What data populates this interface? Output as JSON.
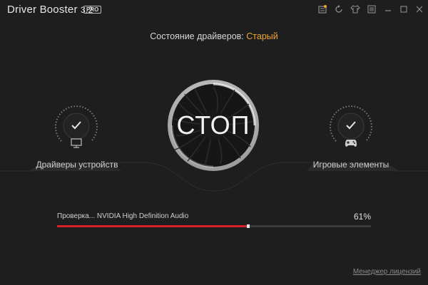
{
  "window": {
    "title": "Driver Booster",
    "version": "3.2",
    "badge": "PRO",
    "controls": [
      {
        "name": "message-icon"
      },
      {
        "name": "refresh-icon"
      },
      {
        "name": "shirt-icon"
      },
      {
        "name": "menu-icon"
      },
      {
        "name": "minimize-icon"
      },
      {
        "name": "maximize-icon"
      },
      {
        "name": "close-icon"
      }
    ]
  },
  "status": {
    "label": "Состояние драйверов:",
    "value": "Старый"
  },
  "left_panel": {
    "label": "Драйверы устройств",
    "icon": "monitor-icon",
    "state_icon": "check-icon"
  },
  "right_panel": {
    "label": "Игровые элементы",
    "icon": "gamepad-icon",
    "state_icon": "check-icon"
  },
  "main_button": {
    "label": "СТОП"
  },
  "scan": {
    "text": "Проверка... NVIDIA High Definition Audio",
    "percent_label": "61%",
    "progress": 0.61
  },
  "footer": {
    "license_link": "Менеджер лицензий"
  },
  "colors": {
    "background": "#1e1e1e",
    "accent_status": "#f0a535",
    "progress": "#d6202a"
  }
}
